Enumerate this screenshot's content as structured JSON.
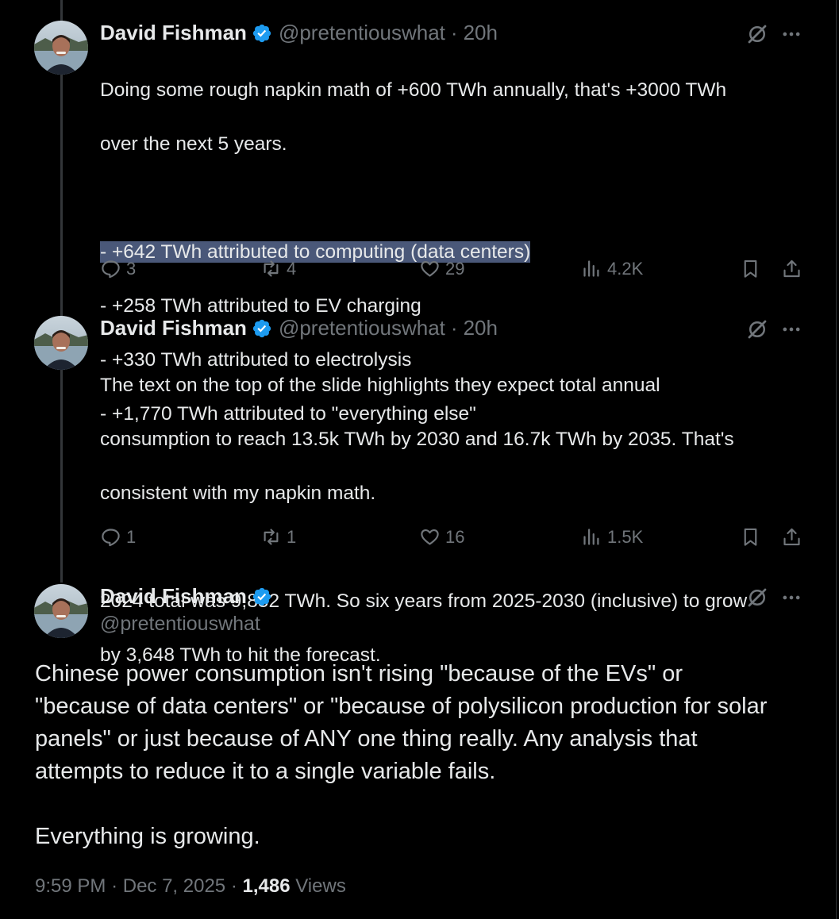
{
  "tweets": [
    {
      "author": "David Fishman",
      "handle": "@pretentiouswhat",
      "separator": "·",
      "time": "20h",
      "lines": [
        "Doing some rough napkin math of +600 TWh annually, that's +3000 TWh",
        "over the next 5 years.",
        "",
        "- +642 TWh attributed to computing (data centers)",
        "- +258 TWh attributed to EV charging",
        "- +330 TWh attributed to electrolysis",
        "- +1,770 TWh attributed to \"everything else\""
      ],
      "replies": "3",
      "reposts": "4",
      "likes": "29",
      "views": "4.2K"
    },
    {
      "author": "David Fishman",
      "handle": "@pretentiouswhat",
      "separator": "·",
      "time": "20h",
      "lines": [
        "The text on the top of the slide highlights they expect total annual",
        "consumption to reach 13.5k TWh by 2030 and 16.7k TWh by 2035. That's",
        "consistent with my napkin math.",
        "",
        "2024 total was 9,852 TWh. So six years from 2025-2030 (inclusive) to grow",
        "by 3,648 TWh to hit the forecast."
      ],
      "replies": "1",
      "reposts": "1",
      "likes": "16",
      "views": "1.5K"
    }
  ],
  "main": {
    "author": "David Fishman",
    "handle": "@pretentiouswhat",
    "lines": [
      "Chinese power consumption isn't rising \"because of the EVs\" or",
      "\"because of data centers\" or \"because of polysilicon production for solar",
      "panels\" or just because of ANY one thing really. Any analysis that",
      "attempts to reduce it to a single variable fails.",
      "",
      "Everything is growing."
    ],
    "time": "9:59 PM",
    "separator": "·",
    "date": "Dec 7, 2025",
    "views_count": "1,486",
    "views_label": "Views"
  },
  "colors": {
    "background": "#000000",
    "text": "#e7e9ea",
    "muted": "#71767b",
    "verified": "#1d9bf0",
    "highlight": "#4a5879"
  },
  "icons": [
    "verified-badge-icon",
    "grok-icon",
    "more-icon",
    "reply-icon",
    "repost-icon",
    "like-icon",
    "views-icon",
    "bookmark-icon",
    "share-icon"
  ]
}
